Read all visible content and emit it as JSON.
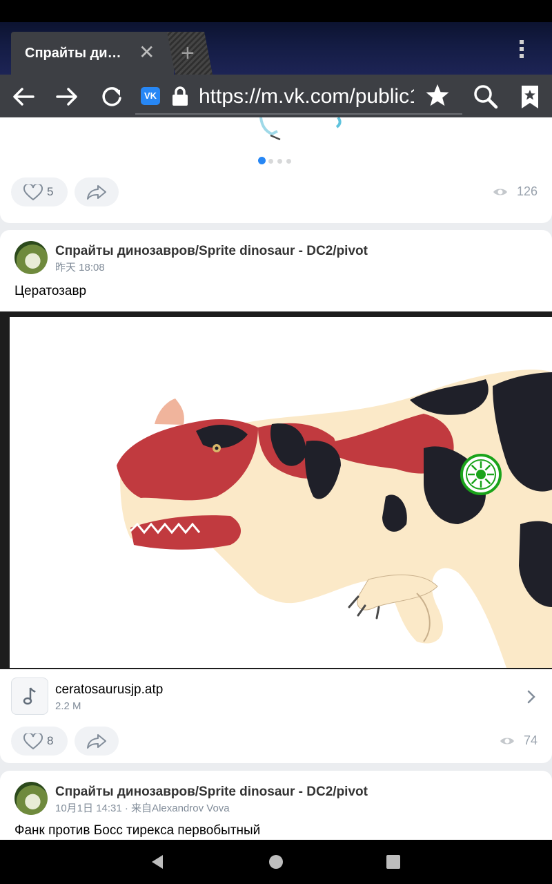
{
  "browser": {
    "tab_title": "Спрайты ди…",
    "close_symbol": "✕",
    "new_tab_symbol": "+",
    "url": "https://m.vk.com/public1",
    "site_badge": "VK"
  },
  "top_card": {
    "likes": "5",
    "views": "126",
    "carousel_pages": 4,
    "carousel_active": 1
  },
  "post1": {
    "author": "Спрайты динозавров/Sprite dinosaur - DC2/pivot",
    "time": "昨天 18:08",
    "text": "Цератозавр",
    "file_name": "ceratosaurusjp.atp",
    "file_size": "2.2 M",
    "likes": "8",
    "views": "74"
  },
  "post2": {
    "author": "Спрайты динозавров/Sprite dinosaur - DC2/pivot",
    "time": "10月1日 14:31 · 来自Alexandrov Vova",
    "text": "Фанк против Босс тирекса первобытный"
  },
  "colors": {
    "accent": "#2787f5",
    "toolbar": "#3d3f44",
    "background": "#ebedf0",
    "dino_red": "#c13a3f",
    "dino_dark": "#1f2029",
    "dino_cream": "#fbe9c8"
  }
}
